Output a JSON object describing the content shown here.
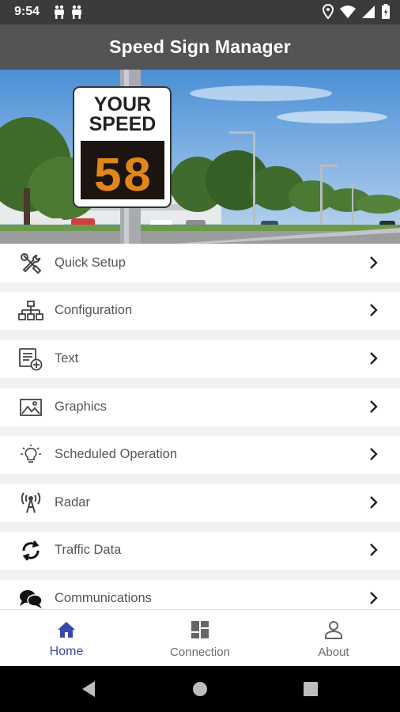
{
  "status_bar": {
    "time": "9:54",
    "icons": [
      "family-icon",
      "location-icon",
      "wifi-icon",
      "signal-icon",
      "battery-icon"
    ]
  },
  "app_bar": {
    "title": "Speed Sign Manager"
  },
  "hero": {
    "sign_text_line1": "YOUR",
    "sign_text_line2": "SPEED",
    "sign_speed": "58"
  },
  "menu": {
    "items": [
      {
        "label": "Quick Setup",
        "icon": "tools-icon"
      },
      {
        "label": "Configuration",
        "icon": "hierarchy-icon"
      },
      {
        "label": "Text",
        "icon": "text-add-icon"
      },
      {
        "label": "Graphics",
        "icon": "image-icon"
      },
      {
        "label": "Scheduled Operation",
        "icon": "lightbulb-icon"
      },
      {
        "label": "Radar",
        "icon": "radar-antenna-icon"
      },
      {
        "label": "Traffic Data",
        "icon": "sync-icon"
      },
      {
        "label": "Communications",
        "icon": "chat-bubbles-icon"
      }
    ]
  },
  "bottom_nav": {
    "home": "Home",
    "connection": "Connection",
    "about": "About"
  },
  "colors": {
    "status_bar": "#3a3b3c",
    "app_bar": "#525456",
    "active_nav": "#3949ab",
    "inactive_nav": "#6b6b6b"
  }
}
